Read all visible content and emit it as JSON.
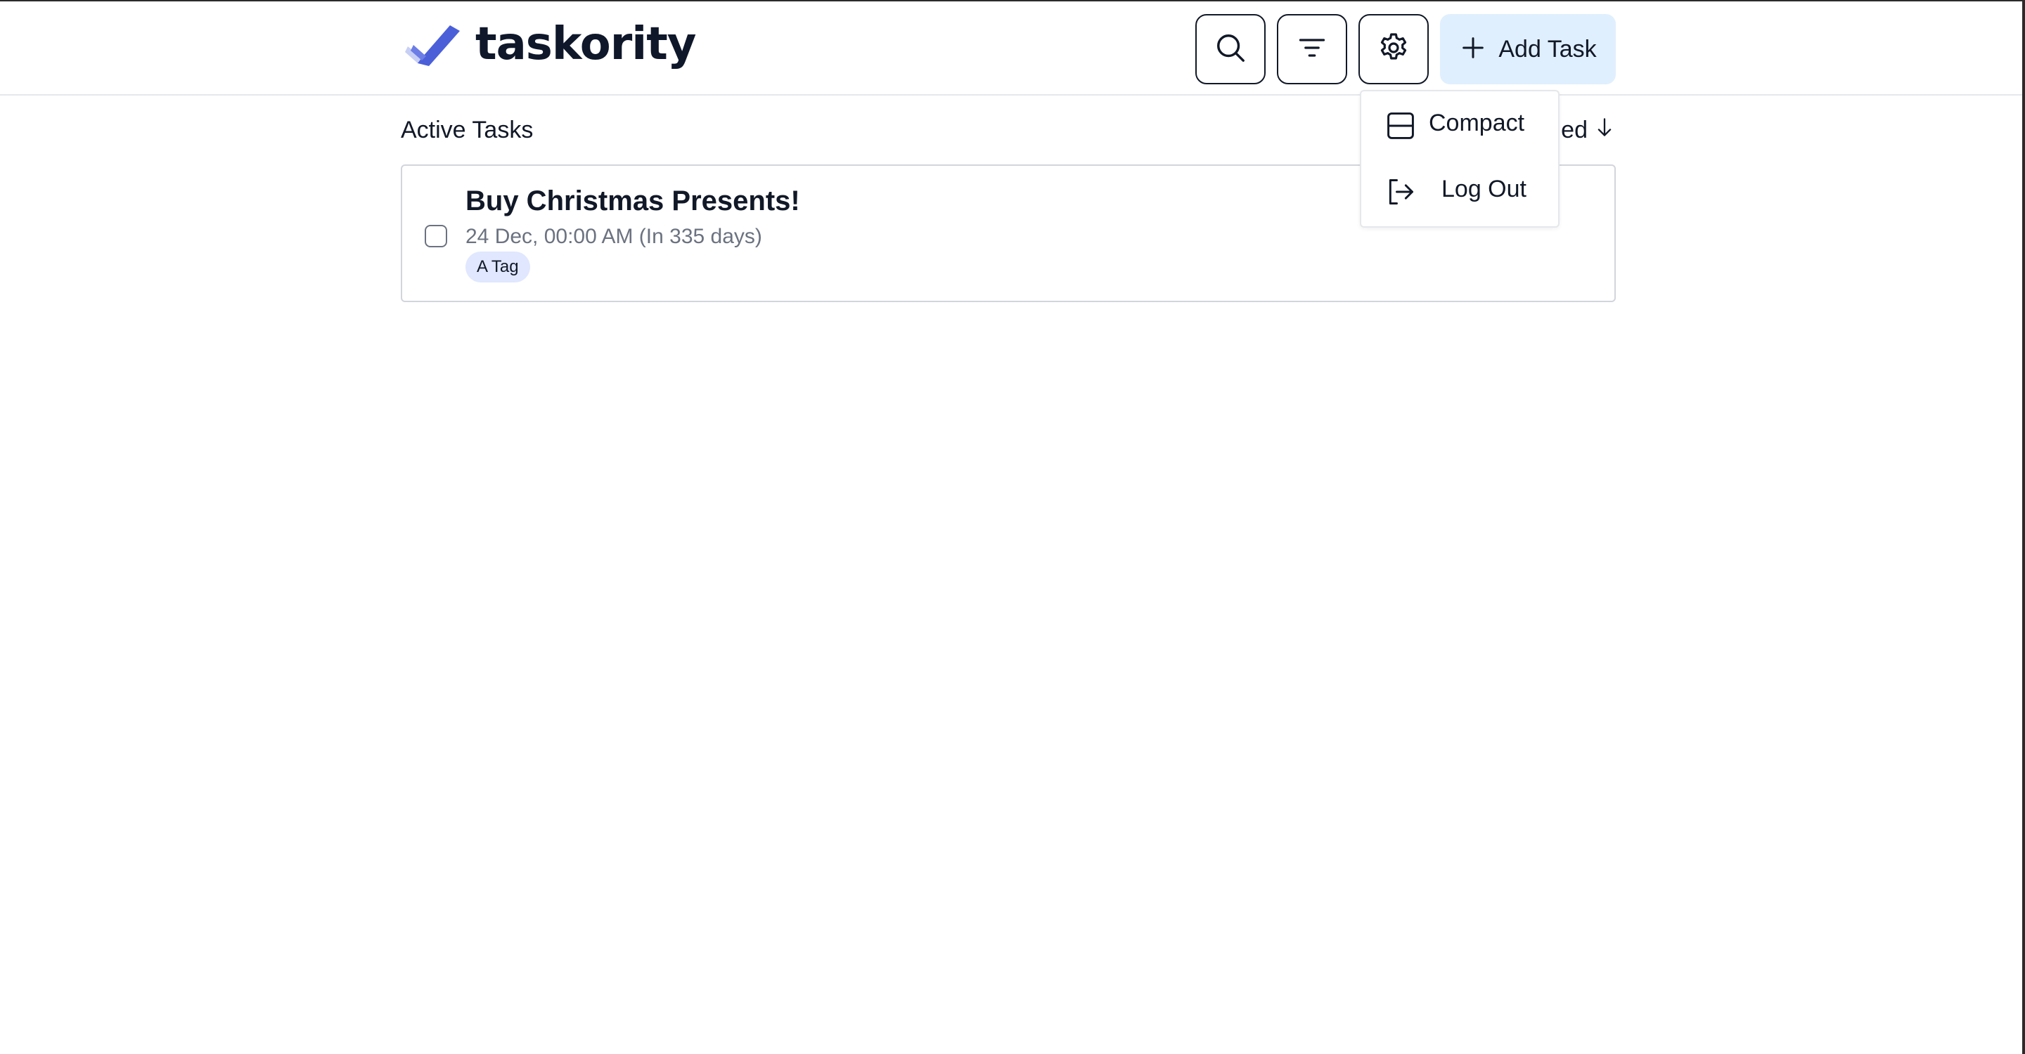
{
  "app": {
    "name": "taskority",
    "accent_color": "#4b5fd9"
  },
  "header": {
    "search_icon": "search-icon",
    "filter_icon": "filter-icon",
    "settings_icon": "gear-icon",
    "add_task_label": "Add Task",
    "add_task_bg": "#e0effe"
  },
  "main": {
    "section_title": "Active Tasks",
    "sort_label": "ed",
    "sort_icon": "arrow-down-icon",
    "tasks": [
      {
        "title": "Buy Christmas Presents!",
        "due": "24 Dec, 00:00 AM (In 335 days)",
        "tags": [
          "A Tag"
        ],
        "completed": false
      }
    ]
  },
  "settings_menu": {
    "items": [
      {
        "label": "Compact",
        "icon": "layout-compact-icon"
      },
      {
        "label": "Log Out",
        "icon": "logout-icon"
      }
    ]
  }
}
